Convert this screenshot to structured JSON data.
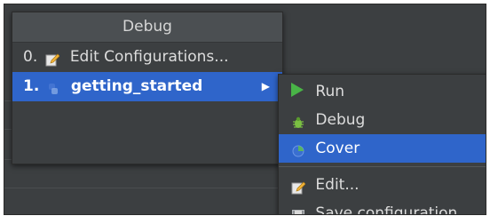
{
  "popup": {
    "title": "Debug",
    "items": [
      {
        "number": "0.",
        "label": "Edit Configurations...",
        "icon": "edit-configurations-icon"
      },
      {
        "number": "1.",
        "label": "getting_started",
        "icon": "python-config-icon",
        "submenu_arrow": "▶"
      }
    ]
  },
  "submenu": {
    "items": [
      {
        "label": "Run",
        "icon": "run-icon"
      },
      {
        "label": "Debug",
        "icon": "debug-bug-icon"
      },
      {
        "label": "Cover",
        "icon": "coverage-icon"
      },
      {
        "label": "Edit...",
        "icon": "edit-icon"
      },
      {
        "label": "Save configuration",
        "icon": "save-icon"
      }
    ]
  },
  "colors": {
    "background": "#3c3f41",
    "selection": "#2f65ca",
    "text": "#dddddd",
    "run_green": "#49b447"
  }
}
